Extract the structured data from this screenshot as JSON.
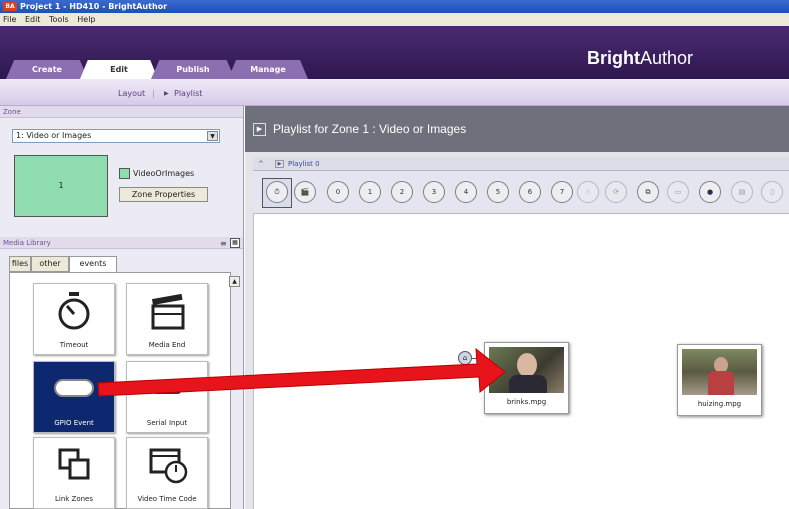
{
  "window": {
    "title": "Project 1 - HD410 - BrightAuthor",
    "icon_text": "BA"
  },
  "menu": [
    "File",
    "Edit",
    "Tools",
    "Help"
  ],
  "brand": {
    "bold": "Bright",
    "rest": "Author"
  },
  "tabs": [
    "Create",
    "Edit",
    "Publish",
    "Manage"
  ],
  "subnav": {
    "layout": "Layout",
    "separator": "|",
    "playlist_arrow": "▶",
    "playlist": "Playlist"
  },
  "zone": {
    "header": "Zone",
    "select_value": "1: Video or Images",
    "preview_label": "1",
    "type_label": "VideoOrImages",
    "properties_button": "Zone Properties"
  },
  "media_library": {
    "header": "Media Library",
    "tabs": [
      "files",
      "other",
      "events"
    ],
    "tiles": [
      "Timeout",
      "Media End",
      "GPIO Event",
      "Serial Input",
      "Link Zones",
      "Video Time Code"
    ]
  },
  "playlist": {
    "zone_title": "Playlist for Zone 1 : Video or Images",
    "collapse": "^",
    "name": "Playlist 0",
    "event_icons": [
      "⏱",
      "🎬",
      "0",
      "1",
      "2",
      "3",
      "4",
      "5",
      "6",
      "7",
      "☝",
      "⟳",
      "⧉",
      "▭",
      "●",
      "▤",
      "▯"
    ],
    "items": [
      "brinks.mpg",
      "huizing.mpg"
    ]
  },
  "colors": {
    "arrow": "#e8141c",
    "header": "#3a2060",
    "zone_bar": "#6e707c",
    "selected_tile": "#0e2870"
  }
}
